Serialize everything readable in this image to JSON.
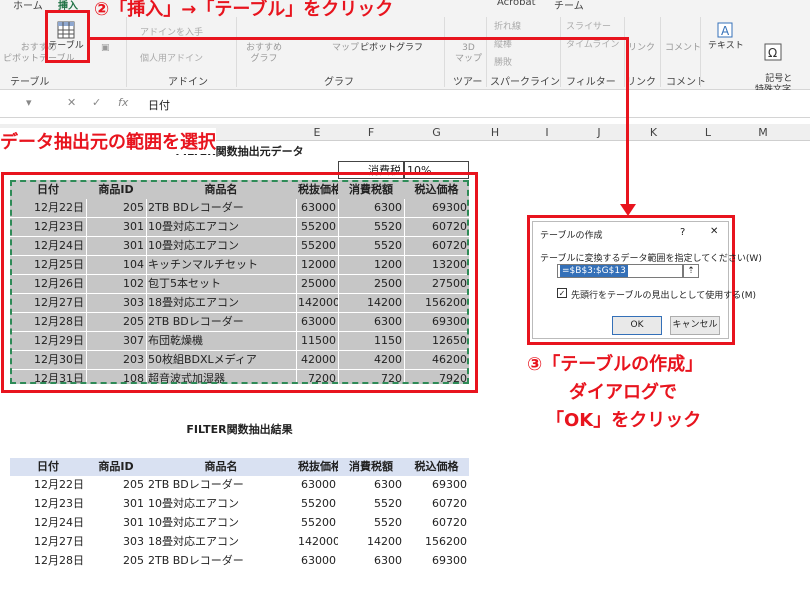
{
  "ribbon_tabs": [
    "ホーム",
    "挿入",
    "Acrobat",
    "チーム"
  ],
  "ribbon": {
    "pivot": "おすすめ\nピボットテーブル",
    "table": "テーブル",
    "group_table": "テーブル",
    "grp_addin": "アドイン",
    "get_addin": "アドインを入手",
    "my_addin": "個人用アドイン",
    "rec_chart": "おすすめ\nグラフ",
    "map": "マップ",
    "pivot_chart": "ピボットグラフ",
    "map3d": "3D\nマップ",
    "line": "折れ線",
    "column": "縦棒",
    "winloss": "勝敗",
    "slicer": "スライサー",
    "timeline": "タイムライン",
    "link": "リンク",
    "comment": "コメント",
    "text": "テキスト",
    "symbol": "記号と\n特殊文字",
    "group_graph": "グラフ",
    "group_tour": "ツアー",
    "group_spark": "スパークライン",
    "group_filter": "フィルター",
    "group_link": "リンク",
    "group_comment": "コメント"
  },
  "formula": {
    "fx": "fx",
    "value": "日付"
  },
  "columns": [
    "E",
    "F",
    "G",
    "H",
    "I",
    "J",
    "K",
    "L",
    "M"
  ],
  "title1": "FILTER関数抽出元データ",
  "tax_label": "消費税",
  "tax_value": "10%",
  "headers": [
    "日付",
    "商品ID",
    "商品名",
    "税抜価格",
    "消費税額",
    "税込価格"
  ],
  "rows": [
    [
      "12月22日",
      "205",
      "2TB BDレコーダー",
      "63000",
      "6300",
      "69300"
    ],
    [
      "12月23日",
      "301",
      "10畳対応エアコン",
      "55200",
      "5520",
      "60720"
    ],
    [
      "12月24日",
      "301",
      "10畳対応エアコン",
      "55200",
      "5520",
      "60720"
    ],
    [
      "12月25日",
      "104",
      "キッチンマルチセット",
      "12000",
      "1200",
      "13200"
    ],
    [
      "12月26日",
      "102",
      "包丁5本セット",
      "25000",
      "2500",
      "27500"
    ],
    [
      "12月27日",
      "303",
      "18畳対応エアコン",
      "142000",
      "14200",
      "156200"
    ],
    [
      "12月28日",
      "205",
      "2TB BDレコーダー",
      "63000",
      "6300",
      "69300"
    ],
    [
      "12月29日",
      "307",
      "布団乾燥機",
      "11500",
      "1150",
      "12650"
    ],
    [
      "12月30日",
      "203",
      "50枚組BDXLメディア",
      "42000",
      "4200",
      "46200"
    ],
    [
      "12月31日",
      "108",
      "超音波式加湿器",
      "7200",
      "720",
      "7920"
    ]
  ],
  "title2": "FILTER関数抽出結果",
  "rows2": [
    [
      "12月22日",
      "205",
      "2TB BDレコーダー",
      "63000",
      "6300",
      "69300"
    ],
    [
      "12月23日",
      "301",
      "10畳対応エアコン",
      "55200",
      "5520",
      "60720"
    ],
    [
      "12月24日",
      "301",
      "10畳対応エアコン",
      "55200",
      "5520",
      "60720"
    ],
    [
      "12月27日",
      "303",
      "18畳対応エアコン",
      "142000",
      "14200",
      "156200"
    ],
    [
      "12月28日",
      "205",
      "2TB BDレコーダー",
      "63000",
      "6300",
      "69300"
    ]
  ],
  "dialog": {
    "title": "テーブルの作成",
    "help": "?",
    "close": "✕",
    "prompt": "テーブルに変換するデータ範囲を指定してください(W)",
    "range": "=$B$3:$G$13",
    "checkbox": "先頭行をテーブルの見出しとして使用する(M)",
    "ok": "OK",
    "cancel": "キャンセル"
  },
  "annotations": {
    "step1": "データ抽出元の範囲を選択",
    "step2": "②「挿入」→「テーブル」をクリック",
    "step3a": "③「テーブルの作成」",
    "step3b": "ダイアログで",
    "step3c": "「OK」をクリック"
  },
  "colors": {
    "accent": "#e8141e",
    "header_fill": "#d9e1f2",
    "selection": "#c6c6c6",
    "marquee": "#2e8b57"
  }
}
